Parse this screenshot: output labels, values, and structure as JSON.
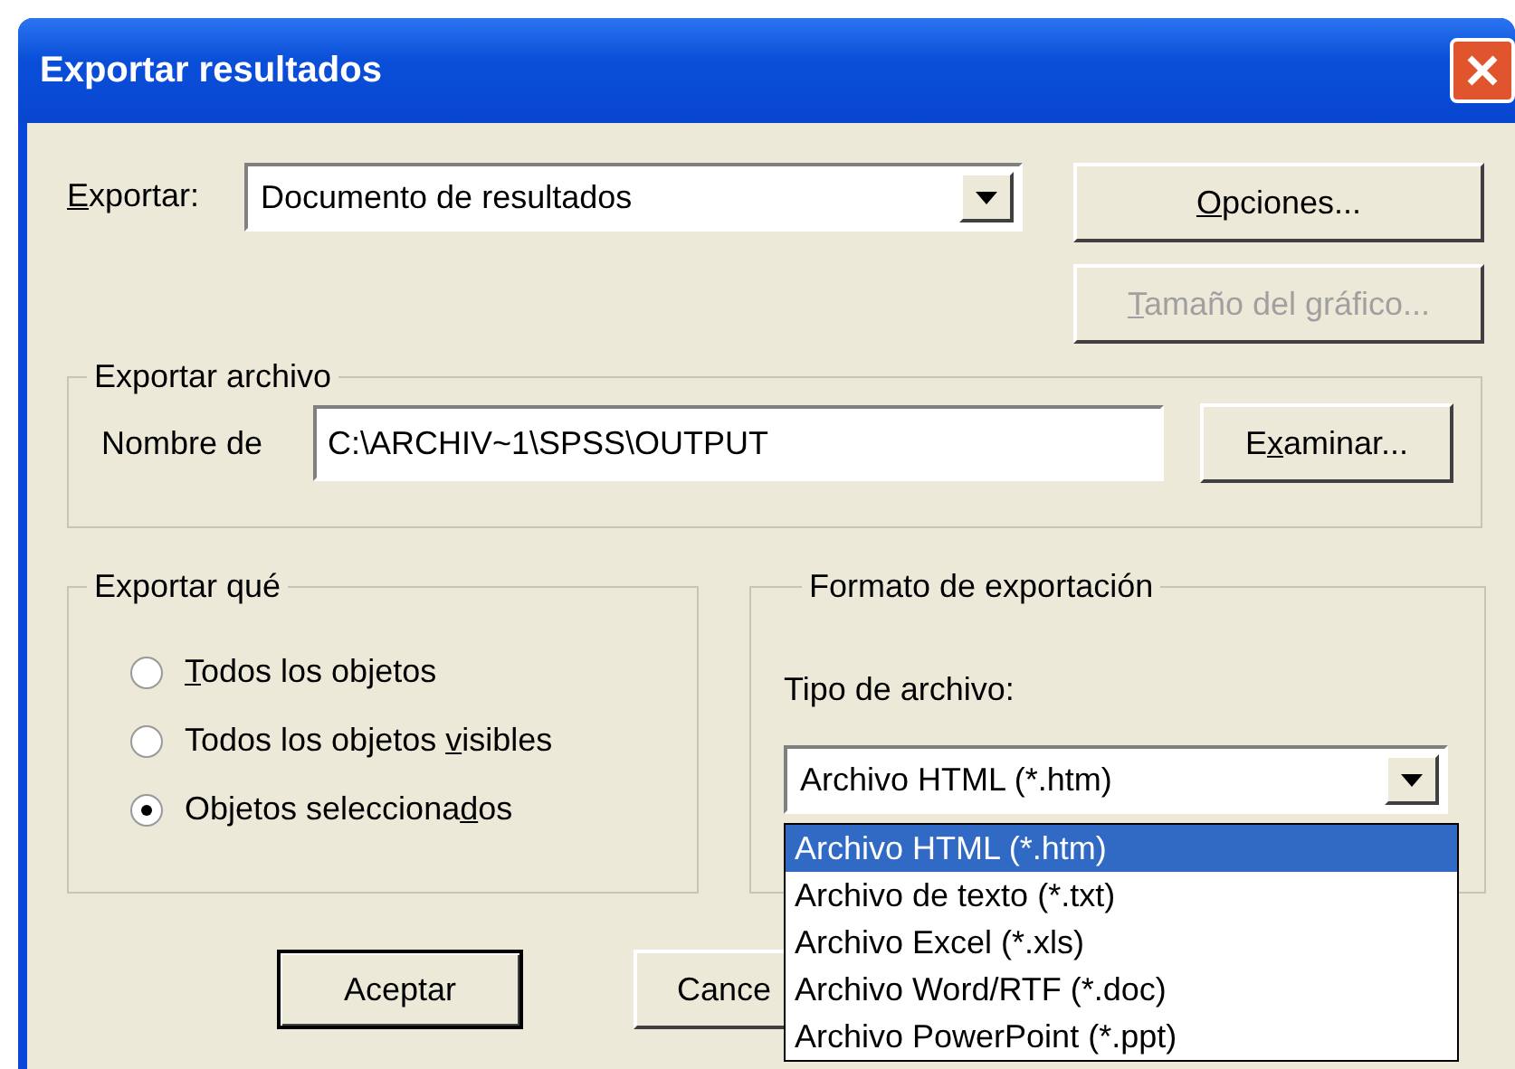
{
  "window": {
    "title": "Exportar resultados"
  },
  "export": {
    "label": {
      "key": "E",
      "post": "xportar:"
    },
    "value": "Documento de resultados"
  },
  "side_buttons": [
    {
      "label": {
        "key": "O",
        "post": "pciones..."
      },
      "disabled": false
    },
    {
      "label": {
        "key": "T",
        "post": "amaño del gráfico..."
      },
      "disabled": true
    }
  ],
  "export_file": {
    "title": "Exportar archivo",
    "label": "Nombre de",
    "value": "C:\\ARCHIV~1\\SPSS\\OUTPUT",
    "browse": {
      "pre": "E",
      "key": "x",
      "post": "aminar..."
    }
  },
  "export_what": {
    "title": "Exportar qué",
    "options": [
      {
        "label": {
          "key": "T",
          "post": "odos los objetos"
        },
        "selected": false
      },
      {
        "label": {
          "pre": "Todos los objetos ",
          "key": "v",
          "post": "isibles"
        },
        "selected": false
      },
      {
        "label": {
          "pre": "Objetos selecciona",
          "key": "d",
          "post": "os"
        },
        "selected": true
      }
    ]
  },
  "format": {
    "title": "Formato de exportación",
    "type_label": "Tipo de archivo:",
    "value": "Archivo HTML (*.htm)",
    "list": [
      {
        "label": "Archivo HTML (*.htm)",
        "selected": true
      },
      {
        "label": "Archivo de texto (*.txt)",
        "selected": false
      },
      {
        "label": "Archivo Excel (*.xls)",
        "selected": false
      },
      {
        "label": "Archivo Word/RTF (*.doc)",
        "selected": false
      },
      {
        "label": "Archivo PowerPoint (*.ppt)",
        "selected": false
      }
    ]
  },
  "buttons": [
    {
      "label": "Aceptar",
      "default": true
    },
    {
      "label": "Cance",
      "default": false
    }
  ]
}
